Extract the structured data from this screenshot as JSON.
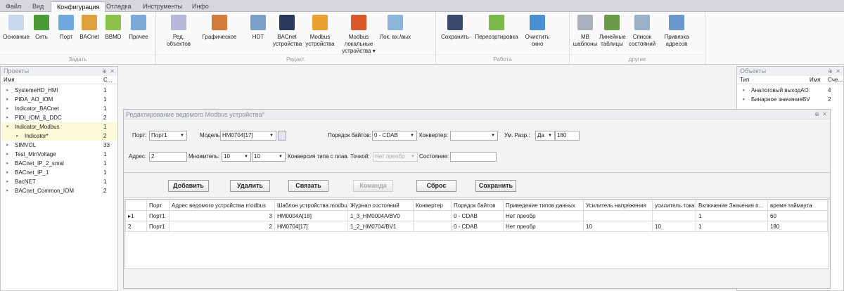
{
  "menu_tabs": [
    "Файл",
    "Вид",
    "Конфигурация",
    "Отладка",
    "Инструменты",
    "Инфо"
  ],
  "ribbon": {
    "groups": [
      {
        "label": "Задать",
        "buttons": [
          "Основные",
          "Сеть",
          "Порт",
          "BACnet",
          "BBMD",
          "Прочее"
        ]
      },
      {
        "label": "Редакт.",
        "buttons": [
          "Ред. объектов",
          "Графическое",
          "HDT",
          "BACnet устройства",
          "Modbus устройства",
          "Modbus локальные устройства ▾",
          "Лок. вх./вых"
        ]
      },
      {
        "label": "Работа",
        "buttons": [
          "Сохранить",
          "Пересортировка",
          "Очистить окно"
        ]
      },
      {
        "label": "другие",
        "buttons": [
          "MB шаблоны",
          "Линейные таблицы",
          "Список состояний",
          "Привязка адресов"
        ]
      }
    ]
  },
  "projects": {
    "title": "Проекты",
    "col_name": "Имя",
    "col_count": "С...",
    "items": [
      {
        "name": "SystemeHD_HMI",
        "count": "1"
      },
      {
        "name": "PIDA_AO_IOM",
        "count": "1"
      },
      {
        "name": "Indicator_BACnet",
        "count": "1"
      },
      {
        "name": "PIDI_IOM_&_DDC",
        "count": "2"
      },
      {
        "name": "Indicator_Modbus",
        "count": "1"
      },
      {
        "name": "Indicator*",
        "count": "2"
      },
      {
        "name": "SIMVOL",
        "count": "33"
      },
      {
        "name": "Test_MinVoltage",
        "count": "1"
      },
      {
        "name": "BACnet_IP_2_smal",
        "count": "1"
      },
      {
        "name": "BACnet_IP_1",
        "count": "1"
      },
      {
        "name": "BacNET",
        "count": "1"
      },
      {
        "name": "BACnet_Common_IOM",
        "count": "2"
      }
    ]
  },
  "objects": {
    "title": "Объекты",
    "col_type": "Тип",
    "col_name": "Имя",
    "col_count": "Сче...",
    "items": [
      {
        "type": "Аналоговый выходAO",
        "count": "4"
      },
      {
        "type": "Бинарное значениеBV",
        "count": "2"
      }
    ]
  },
  "dialog": {
    "title": "Редактирование ведомого Modbus устройства*",
    "port_label": "Порт:",
    "port": "Порт1",
    "model_label": "Модель:",
    "model": "HM0704[17]",
    "byte_order_label": "Порядок байтов:",
    "byte_order": "0 - CDAB",
    "converter_label": "Конвертер:",
    "converter": "",
    "mult_label": "Ум. Разр.:",
    "mult": "Да",
    "mult_value": "180",
    "address_label": "Адрес:",
    "address": "2",
    "multiplier_label": "Множитель:",
    "multiplier1": "10",
    "multiplier2": "10",
    "float_label": "Конверсия типа с плав. Точкой:",
    "float": "Нет преобр",
    "state_label": "Состояние:",
    "state": "",
    "buttons": [
      "Добавить",
      "Удалить",
      "Связать",
      "Команда",
      "Сброс",
      "Сохранить"
    ],
    "columns": [
      "",
      "Порт",
      "Адрес ведомого устройства modbus",
      "Шаблон устройства modbus",
      "Журнал состояний",
      "Конвертер",
      "Порядок байтов",
      "Приведение типов данных",
      "Усилитель напряжения",
      "усилитель тока",
      "Включение Значения п...",
      "время таймаута"
    ],
    "rows": [
      [
        "▸1",
        "Порт1",
        "3",
        "HM0004A[18]",
        "1_3_HM0004A/BV0",
        "",
        "0 - CDAB",
        "Нет преобр",
        "",
        "",
        "1",
        "60"
      ],
      [
        "2",
        "Порт1",
        "2",
        "HM0704[17]",
        "1_2_HM0704/BV1",
        "",
        "0 - CDAB",
        "Нет преобр",
        "10",
        "10",
        "1",
        "180"
      ]
    ]
  }
}
